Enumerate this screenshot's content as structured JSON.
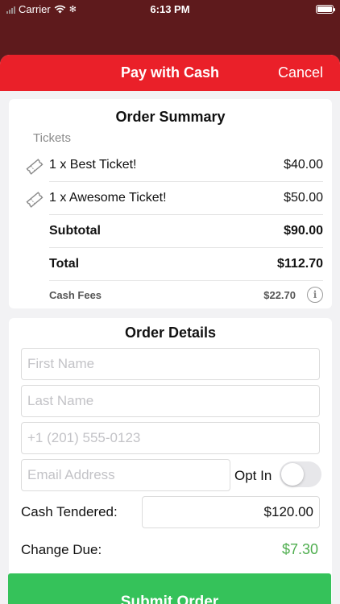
{
  "status_bar": {
    "carrier": "Carrier",
    "time": "6:13 PM"
  },
  "header": {
    "title": "Pay with Cash",
    "cancel_label": "Cancel"
  },
  "summary": {
    "title": "Order Summary",
    "section_label": "Tickets",
    "items": [
      {
        "label": "1 x Best Ticket!",
        "price": "$40.00"
      },
      {
        "label": "1 x Awesome Ticket!",
        "price": "$50.00"
      }
    ],
    "subtotal": {
      "label": "Subtotal",
      "value": "$90.00"
    },
    "total": {
      "label": "Total",
      "value": "$112.70"
    },
    "fees": {
      "label": "Cash Fees",
      "value": "$22.70"
    }
  },
  "details": {
    "title": "Order Details",
    "first_name_placeholder": "First Name",
    "last_name_placeholder": "Last Name",
    "phone_placeholder": "+1 (201) 555-0123",
    "email_placeholder": "Email Address",
    "opt_in_label": "Opt In",
    "opt_in_on": false,
    "cash_tendered_label": "Cash Tendered:",
    "cash_tendered_value": "$120.00",
    "change_due_label": "Change Due:",
    "change_due_value": "$7.30"
  },
  "submit_label": "Submit Order",
  "colors": {
    "brand_red": "#ea2029",
    "submit_green": "#35c25a",
    "change_green": "#4fae4f"
  },
  "icons": {
    "ticket": "ticket-icon",
    "info": "info-icon",
    "wifi": "wifi-icon",
    "battery": "battery-icon"
  }
}
